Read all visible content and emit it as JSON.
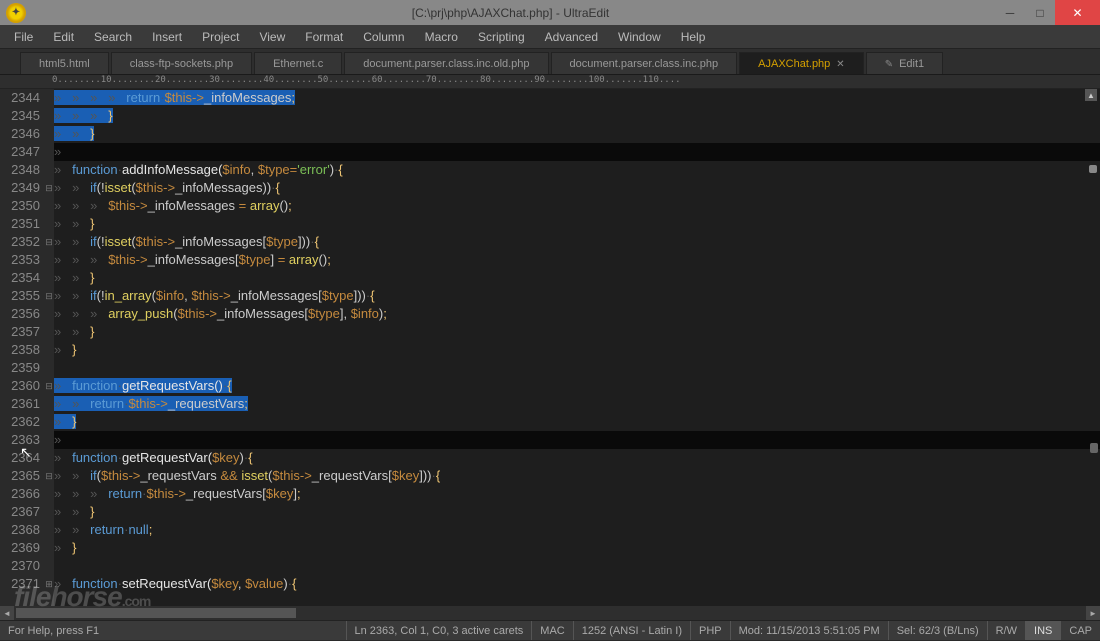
{
  "window": {
    "title": "[C:\\prj\\php\\AJAXChat.php] - UltraEdit"
  },
  "menu": [
    "File",
    "Edit",
    "Search",
    "Insert",
    "Project",
    "View",
    "Format",
    "Column",
    "Macro",
    "Scripting",
    "Advanced",
    "Window",
    "Help"
  ],
  "tabs": [
    {
      "label": "html5.html",
      "active": false,
      "closable": false
    },
    {
      "label": "class-ftp-sockets.php",
      "active": false,
      "closable": false
    },
    {
      "label": "Ethernet.c",
      "active": false,
      "closable": false
    },
    {
      "label": "document.parser.class.inc.old.php",
      "active": false,
      "closable": false
    },
    {
      "label": "document.parser.class.inc.php",
      "active": false,
      "closable": false
    },
    {
      "label": "AJAXChat.php",
      "active": true,
      "closable": true
    },
    {
      "label": "Edit1",
      "active": false,
      "closable": false,
      "icon": true
    }
  ],
  "ruler": "0........10........20........30........40........50........60........70........80........90........100.......110....",
  "lines": [
    {
      "num": "2344",
      "fold": "",
      "sel": true,
      "tokens": [
        [
          "ws",
          "»   »   »   »   "
        ],
        [
          "kw",
          "return"
        ],
        [
          "ws",
          "·"
        ],
        [
          "var",
          "$this"
        ],
        [
          "op",
          "->"
        ],
        [
          "plain",
          "_infoMessages"
        ],
        [
          "punc",
          ";"
        ]
      ]
    },
    {
      "num": "2345",
      "fold": "",
      "sel": true,
      "tokens": [
        [
          "ws",
          "»   »   »   "
        ],
        [
          "punc",
          "}"
        ]
      ]
    },
    {
      "num": "2346",
      "fold": "",
      "sel": true,
      "tokens": [
        [
          "ws",
          "»   »   "
        ],
        [
          "punc",
          "}"
        ]
      ]
    },
    {
      "num": "2347",
      "fold": "",
      "sel": false,
      "lastsel": true,
      "tokens": [
        [
          "ws",
          "»"
        ]
      ]
    },
    {
      "num": "2348",
      "fold": "",
      "sel": false,
      "tokens": [
        [
          "ws",
          "»   "
        ],
        [
          "kw",
          "function"
        ],
        [
          "ws",
          "·"
        ],
        [
          "fnname",
          "addInfoMessage("
        ],
        [
          "var",
          "$info"
        ],
        [
          "plain",
          ", "
        ],
        [
          "var",
          "$type"
        ],
        [
          "op",
          "="
        ],
        [
          "str",
          "'error'"
        ],
        [
          "plain",
          ")"
        ],
        [
          "ws",
          "·"
        ],
        [
          "punc",
          "{"
        ]
      ]
    },
    {
      "num": "2349",
      "fold": "⊟",
      "sel": false,
      "tokens": [
        [
          "ws",
          "»   »   "
        ],
        [
          "kw",
          "if"
        ],
        [
          "plain",
          "(!"
        ],
        [
          "func",
          "isset"
        ],
        [
          "plain",
          "("
        ],
        [
          "var",
          "$this"
        ],
        [
          "op",
          "->"
        ],
        [
          "plain",
          "_infoMessages))"
        ],
        [
          "ws",
          "·"
        ],
        [
          "punc",
          "{"
        ]
      ]
    },
    {
      "num": "2350",
      "fold": "",
      "sel": false,
      "tokens": [
        [
          "ws",
          "»   »   »   "
        ],
        [
          "var",
          "$this"
        ],
        [
          "op",
          "->"
        ],
        [
          "plain",
          "_infoMessages "
        ],
        [
          "op",
          "="
        ],
        [
          "plain",
          " "
        ],
        [
          "func",
          "array"
        ],
        [
          "plain",
          "()"
        ],
        [
          "punc",
          ";"
        ]
      ]
    },
    {
      "num": "2351",
      "fold": "",
      "sel": false,
      "tokens": [
        [
          "ws",
          "»   »   "
        ],
        [
          "punc",
          "}"
        ]
      ]
    },
    {
      "num": "2352",
      "fold": "⊟",
      "sel": false,
      "tokens": [
        [
          "ws",
          "»   »   "
        ],
        [
          "kw",
          "if"
        ],
        [
          "plain",
          "(!"
        ],
        [
          "func",
          "isset"
        ],
        [
          "plain",
          "("
        ],
        [
          "var",
          "$this"
        ],
        [
          "op",
          "->"
        ],
        [
          "plain",
          "_infoMessages["
        ],
        [
          "var",
          "$type"
        ],
        [
          "plain",
          "]))"
        ],
        [
          "ws",
          "·"
        ],
        [
          "punc",
          "{"
        ]
      ]
    },
    {
      "num": "2353",
      "fold": "",
      "sel": false,
      "tokens": [
        [
          "ws",
          "»   »   »   "
        ],
        [
          "var",
          "$this"
        ],
        [
          "op",
          "->"
        ],
        [
          "plain",
          "_infoMessages["
        ],
        [
          "var",
          "$type"
        ],
        [
          "plain",
          "] "
        ],
        [
          "op",
          "="
        ],
        [
          "plain",
          " "
        ],
        [
          "func",
          "array"
        ],
        [
          "plain",
          "()"
        ],
        [
          "punc",
          ";"
        ]
      ]
    },
    {
      "num": "2354",
      "fold": "",
      "sel": false,
      "tokens": [
        [
          "ws",
          "»   »   "
        ],
        [
          "punc",
          "}"
        ]
      ]
    },
    {
      "num": "2355",
      "fold": "⊟",
      "sel": false,
      "tokens": [
        [
          "ws",
          "»   »   "
        ],
        [
          "kw",
          "if"
        ],
        [
          "plain",
          "(!"
        ],
        [
          "func",
          "in_array"
        ],
        [
          "plain",
          "("
        ],
        [
          "var",
          "$info"
        ],
        [
          "plain",
          ", "
        ],
        [
          "var",
          "$this"
        ],
        [
          "op",
          "->"
        ],
        [
          "plain",
          "_infoMessages["
        ],
        [
          "var",
          "$type"
        ],
        [
          "plain",
          "]))"
        ],
        [
          "ws",
          "·"
        ],
        [
          "punc",
          "{"
        ]
      ]
    },
    {
      "num": "2356",
      "fold": "",
      "sel": false,
      "tokens": [
        [
          "ws",
          "»   »   »   "
        ],
        [
          "func",
          "array_push"
        ],
        [
          "plain",
          "("
        ],
        [
          "var",
          "$this"
        ],
        [
          "op",
          "->"
        ],
        [
          "plain",
          "_infoMessages["
        ],
        [
          "var",
          "$type"
        ],
        [
          "plain",
          "], "
        ],
        [
          "var",
          "$info"
        ],
        [
          "plain",
          ")"
        ],
        [
          "punc",
          ";"
        ]
      ]
    },
    {
      "num": "2357",
      "fold": "",
      "sel": false,
      "tokens": [
        [
          "ws",
          "»   »   "
        ],
        [
          "punc",
          "}"
        ]
      ]
    },
    {
      "num": "2358",
      "fold": "",
      "sel": false,
      "tokens": [
        [
          "ws",
          "»   "
        ],
        [
          "punc",
          "}"
        ]
      ]
    },
    {
      "num": "2359",
      "fold": "",
      "sel": false,
      "tokens": [
        [
          "plain",
          ""
        ]
      ]
    },
    {
      "num": "2360",
      "fold": "⊟",
      "sel": true,
      "tokens": [
        [
          "ws",
          "»   "
        ],
        [
          "kw",
          "function"
        ],
        [
          "ws",
          "·"
        ],
        [
          "fnname",
          "getRequestVars()"
        ],
        [
          "ws",
          "·"
        ],
        [
          "punc",
          "{"
        ]
      ]
    },
    {
      "num": "2361",
      "fold": "",
      "sel": true,
      "tokens": [
        [
          "ws",
          "»   »   "
        ],
        [
          "kw",
          "return"
        ],
        [
          "ws",
          "·"
        ],
        [
          "var",
          "$this"
        ],
        [
          "op",
          "->"
        ],
        [
          "plain",
          "_requestVars"
        ],
        [
          "punc",
          ";"
        ]
      ]
    },
    {
      "num": "2362",
      "fold": "",
      "sel": true,
      "tokens": [
        [
          "ws",
          "»   "
        ],
        [
          "punc",
          "}"
        ]
      ]
    },
    {
      "num": "2363",
      "fold": "",
      "sel": false,
      "lastsel": true,
      "tokens": [
        [
          "ws",
          "»"
        ]
      ]
    },
    {
      "num": "2364",
      "fold": "",
      "sel": false,
      "tokens": [
        [
          "ws",
          "»   "
        ],
        [
          "kw",
          "function"
        ],
        [
          "ws",
          "·"
        ],
        [
          "fnname",
          "getRequestVar("
        ],
        [
          "var",
          "$key"
        ],
        [
          "plain",
          ")"
        ],
        [
          "ws",
          "·"
        ],
        [
          "punc",
          "{"
        ]
      ]
    },
    {
      "num": "2365",
      "fold": "⊟",
      "sel": false,
      "tokens": [
        [
          "ws",
          "»   »   "
        ],
        [
          "kw",
          "if"
        ],
        [
          "plain",
          "("
        ],
        [
          "var",
          "$this"
        ],
        [
          "op",
          "->"
        ],
        [
          "plain",
          "_requestVars "
        ],
        [
          "op",
          "&&"
        ],
        [
          "plain",
          " "
        ],
        [
          "func",
          "isset"
        ],
        [
          "plain",
          "("
        ],
        [
          "var",
          "$this"
        ],
        [
          "op",
          "->"
        ],
        [
          "plain",
          "_requestVars["
        ],
        [
          "var",
          "$key"
        ],
        [
          "plain",
          "]))"
        ],
        [
          "ws",
          "·"
        ],
        [
          "punc",
          "{"
        ]
      ]
    },
    {
      "num": "2366",
      "fold": "",
      "sel": false,
      "tokens": [
        [
          "ws",
          "»   »   »   "
        ],
        [
          "kw",
          "return"
        ],
        [
          "ws",
          "·"
        ],
        [
          "var",
          "$this"
        ],
        [
          "op",
          "->"
        ],
        [
          "plain",
          "_requestVars["
        ],
        [
          "var",
          "$key"
        ],
        [
          "plain",
          "]"
        ],
        [
          "punc",
          ";"
        ]
      ]
    },
    {
      "num": "2367",
      "fold": "",
      "sel": false,
      "tokens": [
        [
          "ws",
          "»   »   "
        ],
        [
          "punc",
          "}"
        ]
      ]
    },
    {
      "num": "2368",
      "fold": "",
      "sel": false,
      "tokens": [
        [
          "ws",
          "»   »   "
        ],
        [
          "kw",
          "return"
        ],
        [
          "ws",
          "·"
        ],
        [
          "kw",
          "null"
        ],
        [
          "punc",
          ";"
        ]
      ]
    },
    {
      "num": "2369",
      "fold": "",
      "sel": false,
      "tokens": [
        [
          "ws",
          "»   "
        ],
        [
          "punc",
          "}"
        ]
      ]
    },
    {
      "num": "2370",
      "fold": "",
      "sel": false,
      "tokens": [
        [
          "plain",
          ""
        ]
      ]
    },
    {
      "num": "2371",
      "fold": "⊞",
      "sel": false,
      "tokens": [
        [
          "ws",
          "»   "
        ],
        [
          "kw",
          "function"
        ],
        [
          "ws",
          "·"
        ],
        [
          "fnname",
          "setRequestVar("
        ],
        [
          "var",
          "$key"
        ],
        [
          "plain",
          ", "
        ],
        [
          "var",
          "$value"
        ],
        [
          "plain",
          ")"
        ],
        [
          "ws",
          "·"
        ],
        [
          "punc",
          "{"
        ]
      ]
    }
  ],
  "status": {
    "help": "For Help, press F1",
    "pos": "Ln 2363, Col 1, C0, 3 active carets",
    "lineend": "MAC",
    "codepage": "1252 (ANSI - Latin I)",
    "lang": "PHP",
    "mod": "Mod: 11/15/2013 5:51:05 PM",
    "sel": "Sel: 62/3 (B/Lns)",
    "rw": "R/W",
    "ins": "INS",
    "cap": "CAP"
  },
  "watermark": "filehorse",
  "watermark_suffix": ".com"
}
